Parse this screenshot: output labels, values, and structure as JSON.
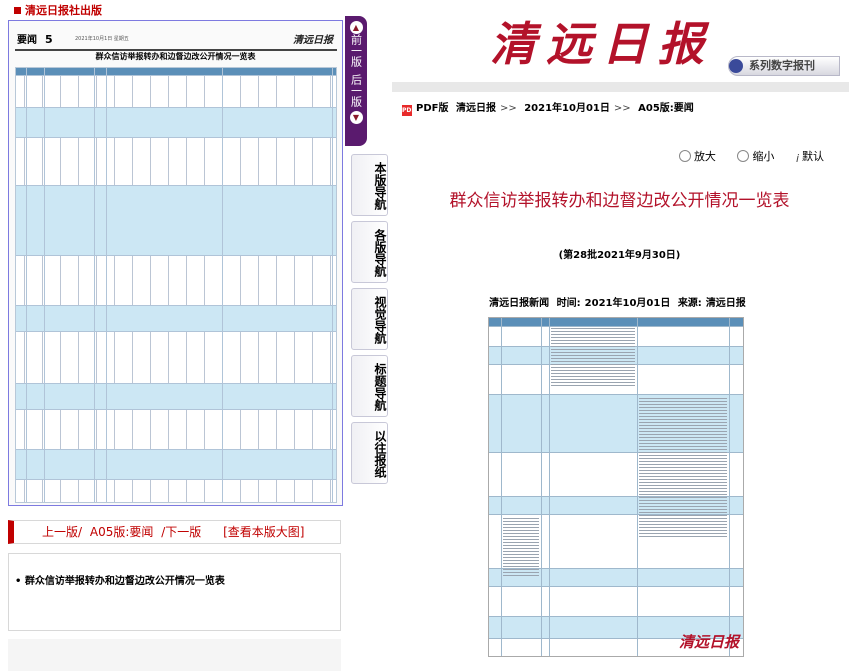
{
  "header": {
    "publisher": "清远日报社出版",
    "masthead": "清远日报",
    "series_badge": "系列数字报刊"
  },
  "paper_preview": {
    "section": "要闻",
    "page_num": "5",
    "date_line": "2021年10月1日 星期五",
    "logo": "清远日报",
    "headline": "群众信访举报转办和边督边改公开情况一览表"
  },
  "page_switch": {
    "prev_label": "前一版",
    "next_label": "后一版"
  },
  "nav_tabs": [
    {
      "label": "本版导航"
    },
    {
      "label": "各版导航"
    },
    {
      "label": "视觉导航"
    },
    {
      "label": "标题导航"
    },
    {
      "label": "以往报纸"
    }
  ],
  "prevnext": {
    "prev": "上一版/",
    "current": "A05版:要闻",
    "next": "/下一版",
    "big": "[查看本版大图]"
  },
  "article_list": [
    {
      "title": "群众信访举报转办和边督边改公开情况一览表"
    }
  ],
  "breadcrumb": {
    "pdf": "PDF版",
    "paper": "清远日报",
    "date": "2021年10月01日",
    "section": "A05版:要闻"
  },
  "zoom_tools": {
    "zoom_in": "放大",
    "zoom_out": "缩小",
    "default": "默认"
  },
  "article": {
    "title": "群众信访举报转办和边督边改公开情况一览表",
    "subtitle": "(第28批2021年9月30日)",
    "source_line": "清远日报新闻",
    "time_label": "时间:",
    "time_value": "2021年10月01日",
    "source_label": "来源:",
    "source_value": "清远日报",
    "image_logo": "清远日报"
  },
  "colors": {
    "brand_red": "#b3122a",
    "accent_purple": "#5a1a6e",
    "table_blue": "#cce7f4"
  }
}
